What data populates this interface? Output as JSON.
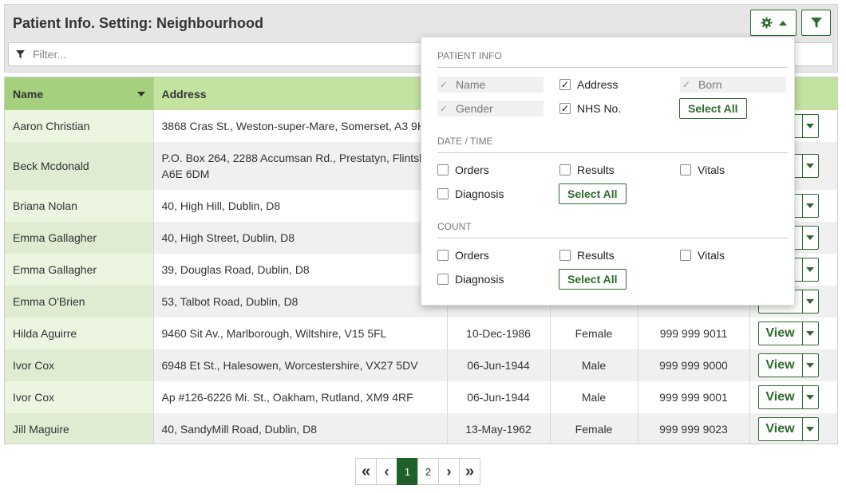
{
  "panel": {
    "title": "Patient Info. Setting: Neighbourhood",
    "filter_placeholder": "Filter..."
  },
  "icons": {
    "settings": "gear-icon",
    "filter": "filter-icon",
    "accent": "#2e6b2e"
  },
  "table": {
    "columns": [
      "Name",
      "Address",
      "",
      "",
      "",
      ""
    ],
    "view_label": "View",
    "rows": [
      {
        "name": "Aaron Christian",
        "address": "3868 Cras St., Weston-super-Mare, Somerset, A3 9H",
        "born": "",
        "gender": "",
        "nhs": ""
      },
      {
        "name": "Beck Mcdonald",
        "address": "P.O. Box 264, 2288 Accumsan Rd., Prestatyn, Flintsh A6E 6DM",
        "born": "",
        "gender": "",
        "nhs": ""
      },
      {
        "name": "Briana Nolan",
        "address": "40, High Hill, Dublin, D8",
        "born": "",
        "gender": "",
        "nhs": ""
      },
      {
        "name": "Emma Gallagher",
        "address": "40, High Street, Dublin, D8",
        "born": "",
        "gender": "",
        "nhs": ""
      },
      {
        "name": "Emma Gallagher",
        "address": "39, Douglas Road, Dublin, D8",
        "born": "",
        "gender": "",
        "nhs": ""
      },
      {
        "name": "Emma O'Brien",
        "address": "53, Talbot Road, Dublin, D8",
        "born": "",
        "gender": "",
        "nhs": ""
      },
      {
        "name": "Hilda Aguirre",
        "address": "9460 Sit Av., Marlborough, Wiltshire, V15 5FL",
        "born": "10-Dec-1986",
        "gender": "Female",
        "nhs": "999 999 9011"
      },
      {
        "name": "Ivor Cox",
        "address": "6948 Et St., Halesowen, Worcestershire, VX27 5DV",
        "born": "06-Jun-1944",
        "gender": "Male",
        "nhs": "999 999 9000"
      },
      {
        "name": "Ivor Cox",
        "address": "Ap #126-6226 Mi. St., Oakham, Rutland, XM9 4RF",
        "born": "06-Jun-1944",
        "gender": "Male",
        "nhs": "999 999 9001"
      },
      {
        "name": "Jill Maguire",
        "address": "40, SandyMill Road, Dublin, D8",
        "born": "13-May-1962",
        "gender": "Female",
        "nhs": "999 999 9023"
      }
    ]
  },
  "dropdown": {
    "patient_info": {
      "title": "PATIENT INFO",
      "options": [
        {
          "label": "Name",
          "checked": true,
          "disabled": true
        },
        {
          "label": "Address",
          "checked": true,
          "disabled": false
        },
        {
          "label": "Born",
          "checked": true,
          "disabled": true
        },
        {
          "label": "Gender",
          "checked": true,
          "disabled": true
        },
        {
          "label": "NHS No.",
          "checked": true,
          "disabled": false
        }
      ],
      "select_all": "Select All"
    },
    "date_time": {
      "title": "DATE / TIME",
      "options": [
        {
          "label": "Orders",
          "checked": false
        },
        {
          "label": "Results",
          "checked": false
        },
        {
          "label": "Vitals",
          "checked": false
        },
        {
          "label": "Diagnosis",
          "checked": false
        }
      ],
      "select_all": "Select All"
    },
    "count": {
      "title": "COUNT",
      "options": [
        {
          "label": "Orders",
          "checked": false
        },
        {
          "label": "Results",
          "checked": false
        },
        {
          "label": "Vitals",
          "checked": false
        },
        {
          "label": "Diagnosis",
          "checked": false
        }
      ],
      "select_all": "Select All"
    }
  },
  "pagination": {
    "first": "«",
    "prev": "‹",
    "pages": [
      "1",
      "2"
    ],
    "active": "1",
    "next": "›",
    "last": "»"
  }
}
